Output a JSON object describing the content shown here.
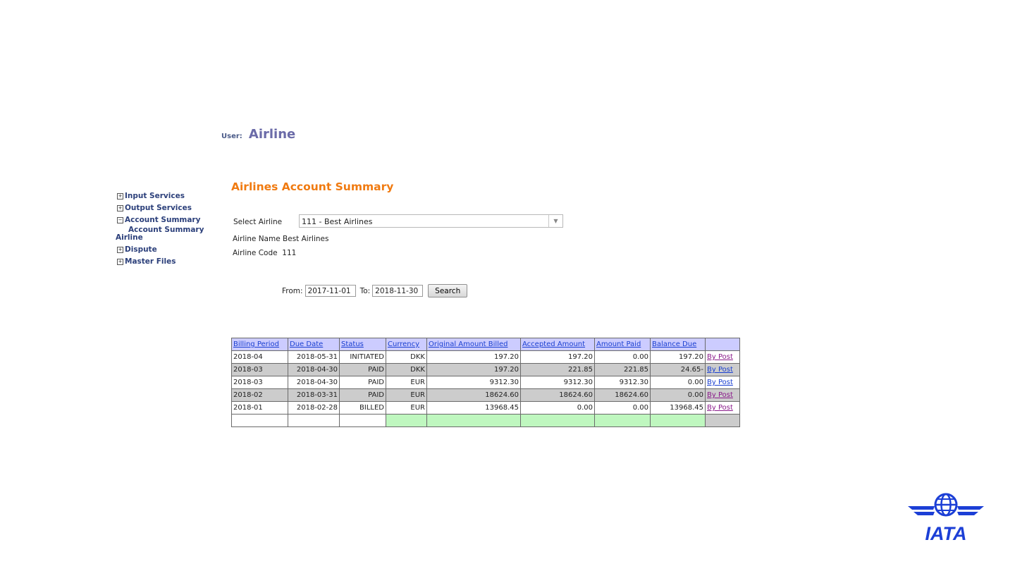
{
  "user": {
    "label": "User:",
    "name": "Airline"
  },
  "nav": {
    "items": [
      {
        "box": "+",
        "label": "Input Services"
      },
      {
        "box": "+",
        "label": "Output Services"
      },
      {
        "box": "−",
        "label": "Account Summary"
      }
    ],
    "sub1": "Account Summary",
    "sub2": "Airline",
    "items2": [
      {
        "box": "+",
        "label": "Dispute"
      },
      {
        "box": "+",
        "label": "Master Files"
      }
    ]
  },
  "page_title": "Airlines Account Summary",
  "select": {
    "label": "Select Airline",
    "value": "111 - Best Airlines",
    "arrow_icon": "chevron-down-icon"
  },
  "airline_name": {
    "label": "Airline Name",
    "value": "Best Airlines"
  },
  "airline_code": {
    "label": "Airline Code",
    "value": "111"
  },
  "dates": {
    "from_label": "From:",
    "from": "2017-11-01",
    "to_label": "To:",
    "to": "2018-11-30",
    "search": "Search"
  },
  "table": {
    "headers": [
      "Billing Period",
      "Due Date",
      "Status",
      "Currency",
      "Original Amount Billed",
      "Accepted Amount",
      "Amount Paid",
      "Balance Due",
      ""
    ],
    "rows": [
      [
        "2018-04",
        "2018-05-31",
        "INITIATED",
        "DKK",
        "197.20",
        "197.20",
        "0.00",
        "197.20",
        "By Post"
      ],
      [
        "2018-03",
        "2018-04-30",
        "PAID",
        "DKK",
        "197.20",
        "221.85",
        "221.85",
        "24.65-",
        "By Post"
      ],
      [
        "2018-03",
        "2018-04-30",
        "PAID",
        "EUR",
        "9312.30",
        "9312.30",
        "9312.30",
        "0.00",
        "By Post"
      ],
      [
        "2018-02",
        "2018-03-31",
        "PAID",
        "EUR",
        "18624.60",
        "18624.60",
        "18624.60",
        "0.00",
        "By Post"
      ],
      [
        "2018-01",
        "2018-02-28",
        "BILLED",
        "EUR",
        "13968.45",
        "0.00",
        "0.00",
        "13968.45",
        "By Post"
      ]
    ]
  },
  "logo": {
    "text": "IATA",
    "color": "#1c3fd6"
  },
  "colors": {
    "accent": "#f07a10",
    "header_bg": "#ccccff",
    "total_bg": "#bff7bf"
  }
}
